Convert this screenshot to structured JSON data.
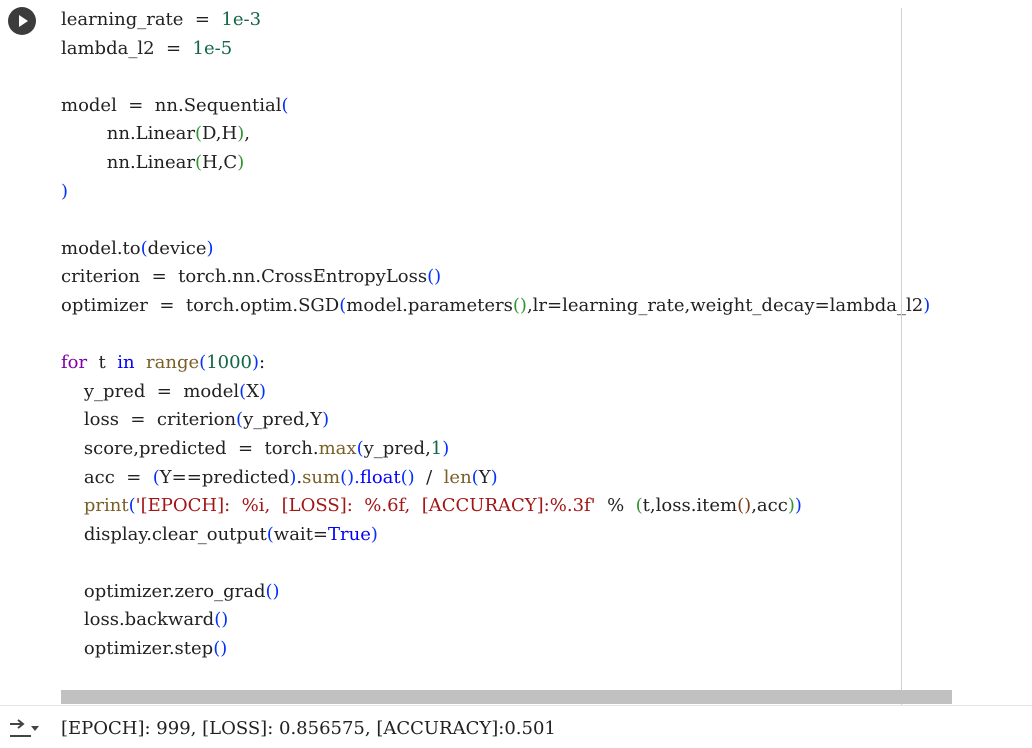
{
  "cell": {
    "run_icon": "play-icon",
    "code_lines": [
      [
        {
          "t": "learning_rate  =  "
        },
        {
          "t": "1e-3",
          "c": "num"
        }
      ],
      [
        {
          "t": "lambda_l2  =  "
        },
        {
          "t": "1e-5",
          "c": "num"
        }
      ],
      [],
      [
        {
          "t": "model  =  nn.Sequential"
        },
        {
          "t": "(",
          "c": "p1"
        }
      ],
      [
        {
          "t": "        nn.Linear"
        },
        {
          "t": "(",
          "c": "p2"
        },
        {
          "t": "D,H"
        },
        {
          "t": ")",
          "c": "p2"
        },
        {
          "t": ","
        }
      ],
      [
        {
          "t": "        nn.Linear"
        },
        {
          "t": "(",
          "c": "p2"
        },
        {
          "t": "H,C"
        },
        {
          "t": ")",
          "c": "p2"
        }
      ],
      [
        {
          "t": ")",
          "c": "p1"
        }
      ],
      [],
      [
        {
          "t": "model.to"
        },
        {
          "t": "(",
          "c": "p1"
        },
        {
          "t": "device"
        },
        {
          "t": ")",
          "c": "p1"
        }
      ],
      [
        {
          "t": "criterion  =  torch.nn.CrossEntropyLoss"
        },
        {
          "t": "()",
          "c": "p1"
        }
      ],
      [
        {
          "t": "optimizer  =  torch.optim.SGD"
        },
        {
          "t": "(",
          "c": "p1"
        },
        {
          "t": "model.parameters"
        },
        {
          "t": "()",
          "c": "p2"
        },
        {
          "t": ",lr=learning_rate,weight_decay=lambda_l2"
        },
        {
          "t": ")",
          "c": "p1"
        }
      ],
      [],
      [
        {
          "t": "for",
          "c": "kw"
        },
        {
          "t": "  t  "
        },
        {
          "t": "in",
          "c": "kw2"
        },
        {
          "t": "  "
        },
        {
          "t": "range",
          "c": "builtin"
        },
        {
          "t": "(",
          "c": "p1"
        },
        {
          "t": "1000",
          "c": "num"
        },
        {
          "t": ")",
          "c": "p1"
        },
        {
          "t": ":"
        }
      ],
      [
        {
          "t": "    y_pred  =  model"
        },
        {
          "t": "(",
          "c": "p1"
        },
        {
          "t": "X"
        },
        {
          "t": ")",
          "c": "p1"
        }
      ],
      [
        {
          "t": "    loss  =  criterion"
        },
        {
          "t": "(",
          "c": "p1"
        },
        {
          "t": "y_pred,Y"
        },
        {
          "t": ")",
          "c": "p1"
        }
      ],
      [
        {
          "t": "    score,predicted  =  torch."
        },
        {
          "t": "max",
          "c": "builtin"
        },
        {
          "t": "(",
          "c": "p1"
        },
        {
          "t": "y_pred,"
        },
        {
          "t": "1",
          "c": "num"
        },
        {
          "t": ")",
          "c": "p1"
        }
      ],
      [
        {
          "t": "    acc  =  "
        },
        {
          "t": "(",
          "c": "p1"
        },
        {
          "t": "Y==predicted"
        },
        {
          "t": ")",
          "c": "p1"
        },
        {
          "t": "."
        },
        {
          "t": "sum",
          "c": "builtin"
        },
        {
          "t": "()",
          "c": "p1"
        },
        {
          "t": ".",
          "c": "p1"
        },
        {
          "t": "float",
          "c": "kw2"
        },
        {
          "t": "()",
          "c": "p1"
        },
        {
          "t": "  /  "
        },
        {
          "t": "len",
          "c": "builtin"
        },
        {
          "t": "(",
          "c": "p1"
        },
        {
          "t": "Y"
        },
        {
          "t": ")",
          "c": "p1"
        }
      ],
      [
        {
          "t": "    "
        },
        {
          "t": "print",
          "c": "builtin"
        },
        {
          "t": "(",
          "c": "p1"
        },
        {
          "t": "'[EPOCH]:  %i,  [LOSS]:  %.6f,  [ACCURACY]:%.3f'",
          "c": "str"
        },
        {
          "t": "  %  "
        },
        {
          "t": "(",
          "c": "p2"
        },
        {
          "t": "t,loss.item"
        },
        {
          "t": "()",
          "c": "p3"
        },
        {
          "t": ",acc"
        },
        {
          "t": ")",
          "c": "p2"
        },
        {
          "t": ")",
          "c": "p1"
        }
      ],
      [
        {
          "t": "    display.clear_output"
        },
        {
          "t": "(",
          "c": "p1"
        },
        {
          "t": "wait="
        },
        {
          "t": "True",
          "c": "const"
        },
        {
          "t": ")",
          "c": "p1"
        }
      ],
      [],
      [
        {
          "t": "    optimizer.zero_grad"
        },
        {
          "t": "()",
          "c": "p1"
        }
      ],
      [
        {
          "t": "    loss.backward"
        },
        {
          "t": "()",
          "c": "p1"
        }
      ],
      [
        {
          "t": "    optimizer.step"
        },
        {
          "t": "()",
          "c": "p1"
        }
      ]
    ]
  },
  "output": {
    "toggle_icon": "output-toggle-icon",
    "text": "[EPOCH]: 999, [LOSS]: 0.856575, [ACCURACY]:0.501"
  }
}
